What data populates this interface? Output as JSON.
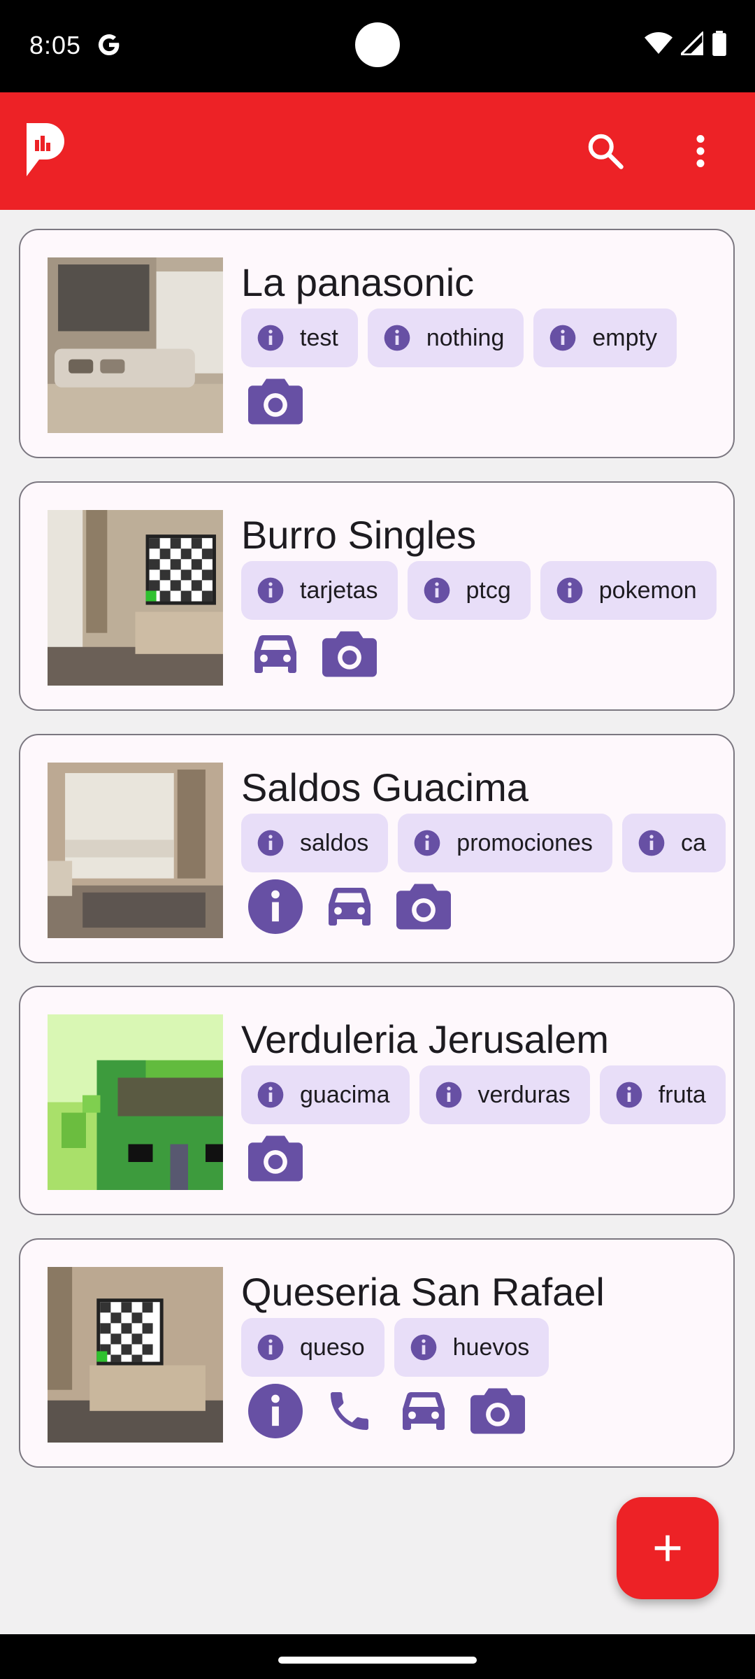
{
  "status_bar": {
    "time": "8:05"
  },
  "app_bar": {
    "logo_icon": "app-logo-icon",
    "search_icon": "search-icon",
    "menu_icon": "more-vert-icon",
    "color": "#ed2226"
  },
  "accent": "#6750a4",
  "cards": [
    {
      "title": "La panasonic",
      "tags": [
        "test",
        "nothing",
        "empty"
      ],
      "actions": [
        "camera"
      ]
    },
    {
      "title": "Burro Singles",
      "tags": [
        "tarjetas",
        "ptcg",
        "pokemon"
      ],
      "actions": [
        "car",
        "camera"
      ]
    },
    {
      "title": "Saldos Guacima",
      "tags": [
        "saldos",
        "promociones",
        "ca"
      ],
      "actions": [
        "info",
        "car",
        "camera"
      ]
    },
    {
      "title": "Verduleria Jerusalem",
      "tags": [
        "guacima",
        "verduras",
        "fruta"
      ],
      "actions": [
        "camera"
      ]
    },
    {
      "title": "Queseria San Rafael",
      "tags": [
        "queso",
        "huevos"
      ],
      "actions": [
        "info",
        "phone",
        "car",
        "camera"
      ]
    }
  ],
  "fab": {
    "icon": "add-icon"
  }
}
